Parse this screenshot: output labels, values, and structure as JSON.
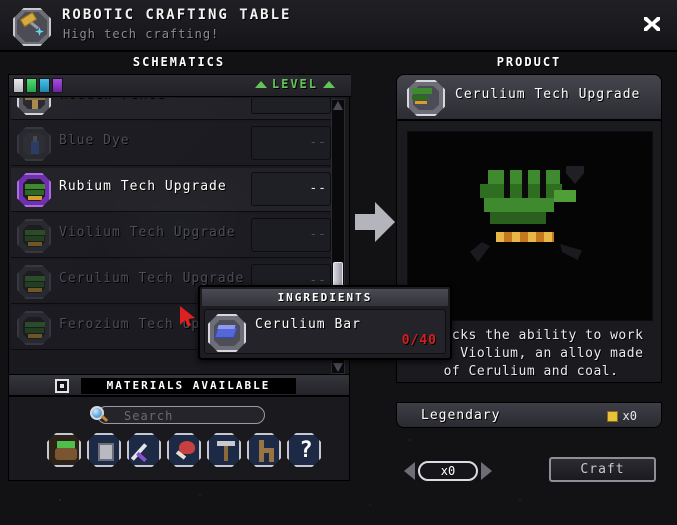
{
  "window": {
    "title": "ROBOTIC CRAFTING TABLE",
    "subtitle": "High tech crafting!",
    "icon": "crafting-table-icon",
    "close_label": "close-icon"
  },
  "sections": {
    "schematics_header": "SCHEMATICS",
    "product_header": "PRODUCT"
  },
  "filters": {
    "rarity_swatches": [
      "#e8e8ea",
      "#4ddc72",
      "#46c4e8",
      "#a74ce0"
    ],
    "sort_label": "LEVEL",
    "sort_direction": "ascending"
  },
  "schematics": {
    "items": [
      {
        "name": "Wooden Fence",
        "level": "--",
        "enabled": true,
        "icon": "fence-icon",
        "rarity": "common"
      },
      {
        "name": "Blue Dye",
        "level": "--",
        "enabled": false,
        "icon": "dye-icon",
        "rarity": "common"
      },
      {
        "name": "Rubium Tech Upgrade",
        "level": "--",
        "enabled": true,
        "icon": "tech-chip-icon",
        "rarity": "legendary"
      },
      {
        "name": "Violium Tech Upgrade",
        "level": "--",
        "enabled": false,
        "icon": "tech-chip-icon",
        "rarity": "legendary"
      },
      {
        "name": "Cerulium Tech Upgrade",
        "level": "--",
        "enabled": false,
        "icon": "tech-chip-icon",
        "rarity": "legendary"
      },
      {
        "name": "Ferozium Tech Upgrade",
        "level": "--",
        "enabled": false,
        "icon": "tech-chip-icon",
        "rarity": "legendary"
      }
    ]
  },
  "materials": {
    "header": "MATERIALS AVAILABLE",
    "search_placeholder": "Search",
    "search_value": "",
    "categories": [
      {
        "name": "plants-category",
        "icon": "plant-icon"
      },
      {
        "name": "blocks-category",
        "icon": "block-icon"
      },
      {
        "name": "weapons-category",
        "icon": "sword-icon"
      },
      {
        "name": "food-category",
        "icon": "meat-icon"
      },
      {
        "name": "tools-category",
        "icon": "hammer-icon"
      },
      {
        "name": "furniture-category",
        "icon": "chair-icon"
      },
      {
        "name": "other-category",
        "icon": "question-mark-icon"
      }
    ]
  },
  "tooltip": {
    "header": "INGREDIENTS",
    "ingredients": [
      {
        "name": "Cerulium Bar",
        "have": 0,
        "need": 40,
        "count_text": "0/40",
        "icon": "ore-bar-icon"
      }
    ],
    "count_color": "#d62020"
  },
  "product": {
    "name": "Cerulium Tech Upgrade",
    "icon": "tech-chip-icon",
    "description": "Unlocks the ability to work with Violium, an alloy made of Cerulium and coal.",
    "rarity": "Legendary",
    "owned_text": "x0",
    "preview": "tech-chip-art"
  },
  "controls": {
    "quantity_text": "x0",
    "decrement": "decrement-icon",
    "increment": "increment-icon",
    "craft_label": "Craft"
  }
}
